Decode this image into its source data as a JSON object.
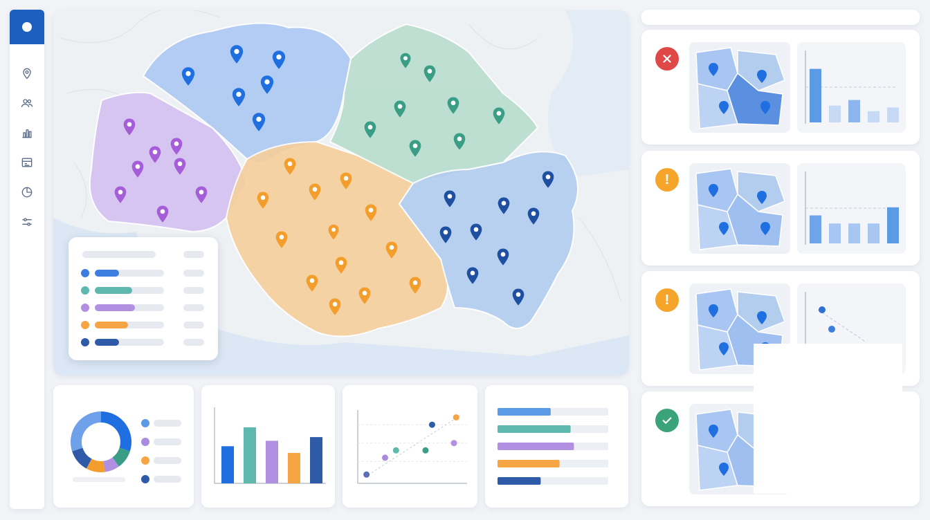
{
  "app": {
    "brand_color": "#1d5fbf"
  },
  "sidebar": {
    "logo_icon": "app-logo",
    "items": [
      {
        "name": "map-pin",
        "icon": "map-pin-icon"
      },
      {
        "name": "users",
        "icon": "users-icon"
      },
      {
        "name": "bar-chart",
        "icon": "bar-chart-icon"
      },
      {
        "name": "table",
        "icon": "table-icon"
      },
      {
        "name": "pie-chart",
        "icon": "pie-chart-icon"
      },
      {
        "name": "filters",
        "icon": "sliders-icon"
      }
    ]
  },
  "map": {
    "regions": [
      {
        "name": "north",
        "color": "#a9c6f2",
        "pin_color": "#1f6fe0"
      },
      {
        "name": "north-east",
        "color": "#b5dccb",
        "pin_color": "#3a9e86"
      },
      {
        "name": "west",
        "color": "#d5c1f1",
        "pin_color": "#a55ed8"
      },
      {
        "name": "central",
        "color": "#f6cf9b",
        "pin_color": "#f29d2c"
      },
      {
        "name": "south-east",
        "color": "#b3cdef",
        "pin_color": "#1e4fa1"
      }
    ],
    "legend": {
      "items": [
        {
          "color": "#3d7de0",
          "fill": 0.35
        },
        {
          "color": "#5fb8ae",
          "fill": 0.54
        },
        {
          "color": "#b190e2",
          "fill": 0.58
        },
        {
          "color": "#f5a543",
          "fill": 0.48
        },
        {
          "color": "#2f5aa8",
          "fill": 0.35
        }
      ]
    }
  },
  "bottom_charts": {
    "donut": {
      "slices": [
        {
          "color": "#1f6fe0",
          "value": 30
        },
        {
          "color": "#3a9e86",
          "value": 10
        },
        {
          "color": "#b190e2",
          "value": 8
        },
        {
          "color": "#f29d2c",
          "value": 10
        },
        {
          "color": "#2f5aa8",
          "value": 12
        },
        {
          "color": "#6fa0ea",
          "value": 30
        }
      ],
      "legend_colors": [
        "#5b9be6",
        "#a98be0",
        "#f5a543",
        "#2f5aa8"
      ]
    },
    "bars": {
      "values": [
        0.61,
        0.92,
        0.7,
        0.5,
        0.76
      ],
      "colors": [
        "#1f6fe0",
        "#5fb8ae",
        "#b190e2",
        "#f5a543",
        "#2f5aa8"
      ]
    },
    "scatter": {
      "points": [
        {
          "x": 0.25,
          "y": 0.35,
          "color": "#a98be0"
        },
        {
          "x": 0.08,
          "y": 0.12,
          "color": "#5a6fb8"
        },
        {
          "x": 0.35,
          "y": 0.45,
          "color": "#5fb8ae"
        },
        {
          "x": 0.68,
          "y": 0.8,
          "color": "#2f5aa8"
        },
        {
          "x": 0.62,
          "y": 0.45,
          "color": "#3a9e86"
        },
        {
          "x": 0.9,
          "y": 0.9,
          "color": "#f5a543"
        },
        {
          "x": 0.88,
          "y": 0.55,
          "color": "#b190e2"
        }
      ]
    },
    "hbars": {
      "fills": [
        0.48,
        0.66,
        0.69,
        0.56,
        0.39
      ],
      "colors": [
        "#5b9be6",
        "#5fb8ae",
        "#b190e2",
        "#f5a543",
        "#2f5aa8"
      ]
    }
  },
  "right_panel": {
    "cards": [
      {
        "status": "error",
        "status_icon": "x-icon",
        "status_color": "#e04848",
        "mini_chart": "bars",
        "bars": [
          0.86,
          0.27,
          0.36,
          0.18,
          0.24
        ]
      },
      {
        "status": "warning",
        "status_icon": "exclamation-icon",
        "status_color": "#f5a52a",
        "mini_chart": "bars",
        "bars": [
          0.45,
          0.32,
          0.32,
          0.32,
          0.58
        ]
      },
      {
        "status": "warning",
        "status_icon": "exclamation-icon",
        "status_color": "#f5a52a",
        "mini_chart": "scatter",
        "bars": []
      },
      {
        "status": "ok",
        "status_icon": "check-icon",
        "status_color": "#3aa37a",
        "mini_chart": "none",
        "bars": []
      }
    ]
  }
}
